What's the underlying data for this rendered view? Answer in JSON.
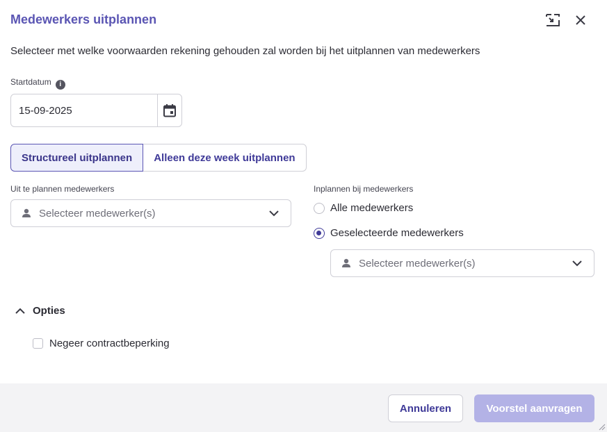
{
  "dialog": {
    "title": "Medewerkers uitplannen",
    "subtitle": "Selecteer met welke voorwaarden rekening gehouden zal worden bij het uitplannen van medewerkers",
    "expand_icon": "expand-icon",
    "close_icon": "close-icon"
  },
  "startdate": {
    "label": "Startdatum",
    "info_icon": "info-icon",
    "value": "15-09-2025",
    "calendar_icon": "calendar-icon"
  },
  "mode_tabs": [
    {
      "label": "Structureel uitplannen",
      "active": true
    },
    {
      "label": "Alleen deze week uitplannen",
      "active": false
    }
  ],
  "left_select": {
    "label": "Uit te plannen medewerkers",
    "placeholder": "Selecteer medewerker(s)"
  },
  "right_group": {
    "label": "Inplannen bij medewerkers",
    "options": [
      {
        "label": "Alle medewerkers",
        "selected": false
      },
      {
        "label": "Geselecteerde medewerkers",
        "selected": true
      }
    ],
    "select_placeholder": "Selecteer medewerker(s)"
  },
  "options": {
    "title": "Opties",
    "expanded": true,
    "checkbox_label": "Negeer contractbeperking",
    "checkbox_checked": false
  },
  "footer": {
    "cancel_label": "Annuleren",
    "submit_label": "Voorstel aanvragen",
    "submit_enabled": false
  },
  "colors": {
    "accent": "#5a55b3",
    "accent_dark": "#3f3a98",
    "disabled_button": "#b3b2e6",
    "footer_bg": "#f3f3f5"
  }
}
